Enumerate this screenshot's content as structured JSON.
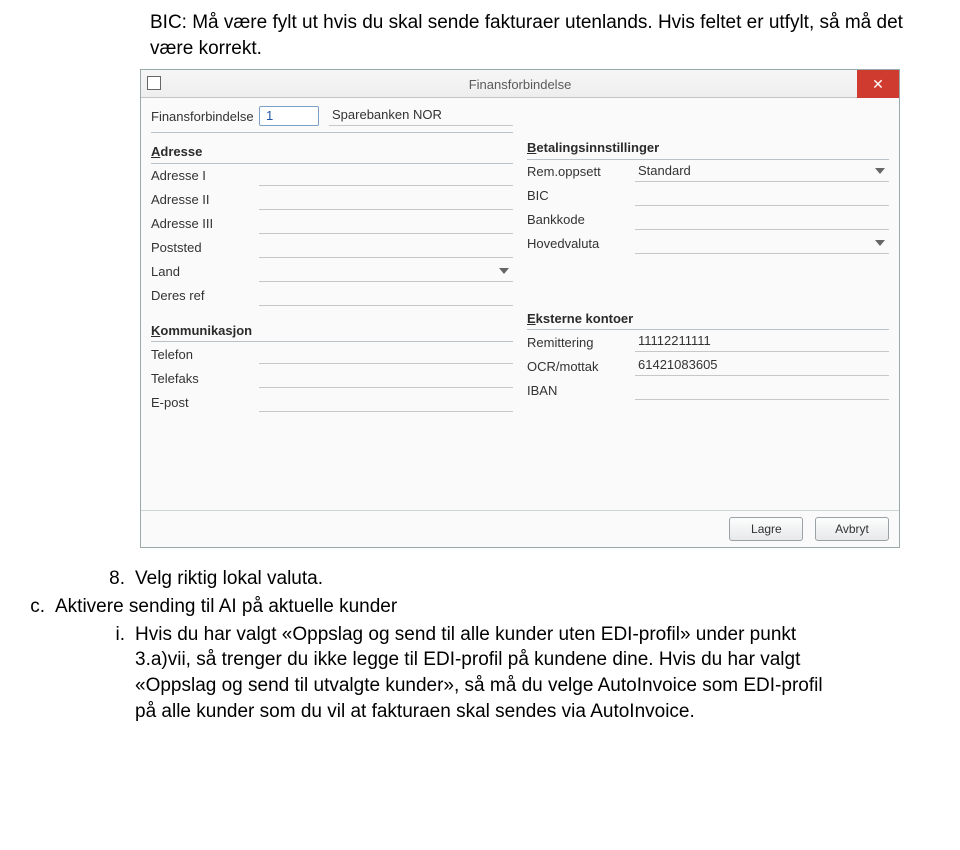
{
  "intro": "BIC: Må være fylt ut hvis du skal sende fakturaer utenlands. Hvis feltet er utfylt, så må det være korrekt.",
  "window": {
    "title": "Finansforbindelse",
    "close_glyph": "✕"
  },
  "top": {
    "label": "Finansforbindelse",
    "code": "1",
    "name": "Sparebanken NOR"
  },
  "left": {
    "sections": {
      "adresse": "Adresse",
      "kommunikasjon": "Kommunikasjon"
    },
    "fields": {
      "adresse1": "Adresse I",
      "adresse2": "Adresse II",
      "adresse3": "Adresse III",
      "poststed": "Poststed",
      "land": "Land",
      "deresref": "Deres ref",
      "telefon": "Telefon",
      "telefaks": "Telefaks",
      "epost": "E-post"
    },
    "values": {
      "adresse1": "",
      "adresse2": "",
      "adresse3": "",
      "poststed": "",
      "land": "",
      "deresref": "",
      "telefon": "",
      "telefaks": "",
      "epost": ""
    }
  },
  "right": {
    "sections": {
      "betaling": "Betalingsinnstillinger",
      "eksterne": "Eksterne kontoer"
    },
    "fields": {
      "remoppsett": "Rem.oppsett",
      "bic": "BIC",
      "bankkode": "Bankkode",
      "hovedvaluta": "Hovedvaluta",
      "remittering": "Remittering",
      "ocrmottak": "OCR/mottak",
      "iban": "IBAN"
    },
    "values": {
      "remoppsett": "Standard",
      "bic": "",
      "bankkode": "",
      "hovedvaluta": "",
      "remittering": "11112211111",
      "ocrmottak": "61421083605",
      "iban": ""
    }
  },
  "buttons": {
    "save": "Lagre",
    "cancel": "Avbryt"
  },
  "list": {
    "n8": "8.",
    "n8_text": "Velg riktig lokal valuta.",
    "c": "c.",
    "c_text": "Aktivere sending til AI på aktuelle kunder",
    "i": "i.",
    "i_text": "Hvis du har valgt «Oppslag og send til alle kunder uten EDI-profil» under punkt 3.a)vii, så trenger du ikke legge til EDI-profil på kundene dine. Hvis du har valgt «Oppslag og send til utvalgte kunder», så må du velge AutoInvoice som EDI-profil på alle kunder som du vil at fakturaen skal sendes via AutoInvoice."
  }
}
